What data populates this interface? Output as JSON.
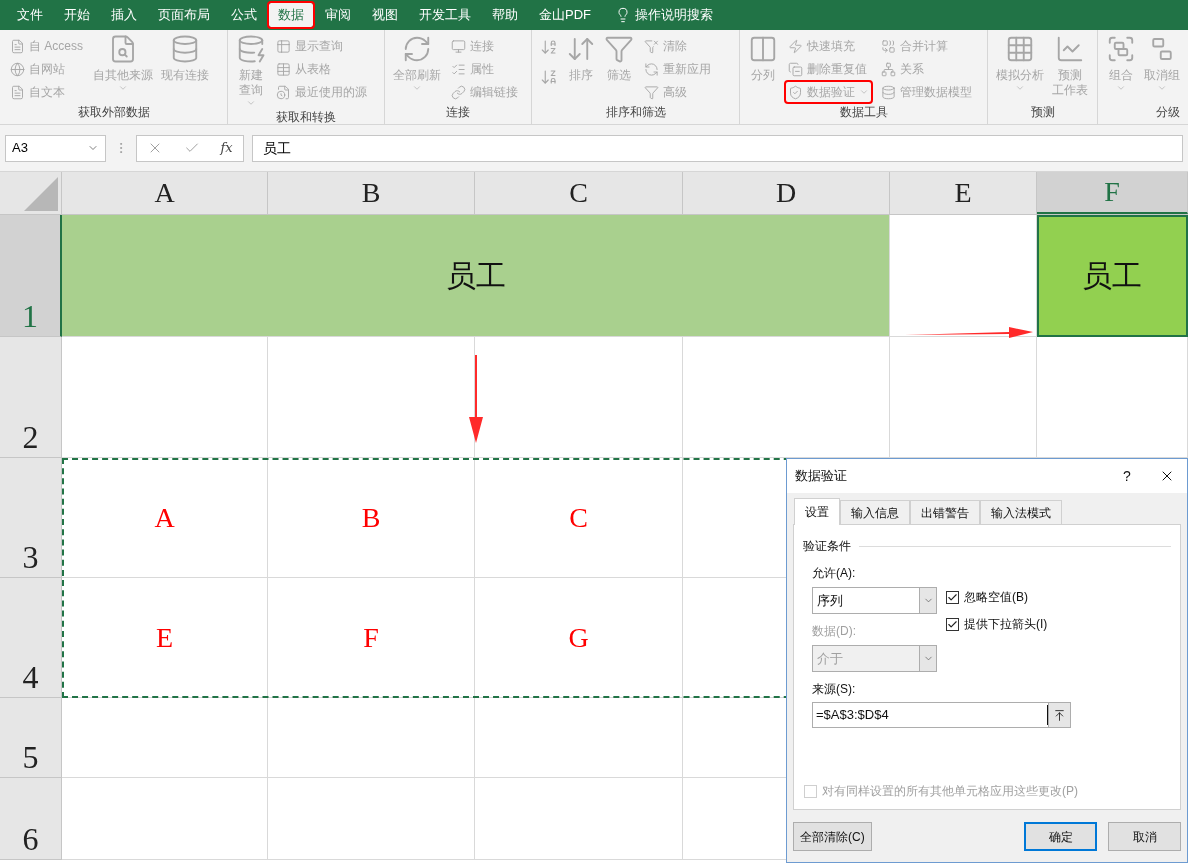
{
  "menu_tabs": [
    {
      "label": "文件",
      "selected": false,
      "highlighted": false
    },
    {
      "label": "开始",
      "selected": false,
      "highlighted": false
    },
    {
      "label": "插入",
      "selected": false,
      "highlighted": false
    },
    {
      "label": "页面布局",
      "selected": false,
      "highlighted": false
    },
    {
      "label": "公式",
      "selected": false,
      "highlighted": false
    },
    {
      "label": "数据",
      "selected": true,
      "highlighted": true
    },
    {
      "label": "审阅",
      "selected": false,
      "highlighted": false
    },
    {
      "label": "视图",
      "selected": false,
      "highlighted": false
    },
    {
      "label": "开发工具",
      "selected": false,
      "highlighted": false
    },
    {
      "label": "帮助",
      "selected": false,
      "highlighted": false
    },
    {
      "label": "金山PDF",
      "selected": false,
      "highlighted": false
    }
  ],
  "tell_me": {
    "placeholder": "操作说明搜索"
  },
  "ribbon": {
    "dimmed": true,
    "groups": [
      {
        "label": "获取外部数据",
        "items": [
          {
            "kind": "stack",
            "items": [
              {
                "label": "自 Access",
                "highlighted": false
              },
              {
                "label": "自网站",
                "highlighted": false
              },
              {
                "label": "自文本",
                "highlighted": false
              }
            ]
          },
          {
            "kind": "large",
            "label": "自其他来源",
            "caret": true
          },
          {
            "kind": "large",
            "label": "现有连接",
            "caret": false
          }
        ]
      },
      {
        "label": "获取和转换",
        "items": [
          {
            "kind": "large",
            "lines": [
              "新建",
              "查询"
            ],
            "caret": true
          },
          {
            "kind": "stack",
            "items": [
              {
                "label": "显示查询",
                "highlighted": false
              },
              {
                "label": "从表格",
                "highlighted": false
              },
              {
                "label": "最近使用的源",
                "highlighted": false
              }
            ]
          }
        ]
      },
      {
        "label": "连接",
        "items": [
          {
            "kind": "large",
            "label": "全部刷新",
            "caret": true
          },
          {
            "kind": "stack",
            "items": [
              {
                "label": "连接",
                "highlighted": false
              },
              {
                "label": "属性",
                "highlighted": false
              },
              {
                "label": "编辑链接",
                "highlighted": false
              }
            ]
          }
        ]
      },
      {
        "label": "排序和筛选",
        "items": [
          {
            "kind": "sort_icons"
          },
          {
            "kind": "large",
            "label": "排序",
            "caret": false
          },
          {
            "kind": "large",
            "label": "筛选",
            "caret": false
          },
          {
            "kind": "stack",
            "items": [
              {
                "label": "清除",
                "highlighted": false
              },
              {
                "label": "重新应用",
                "highlighted": false
              },
              {
                "label": "高级",
                "highlighted": false
              }
            ]
          }
        ]
      },
      {
        "label": "数据工具",
        "items": [
          {
            "kind": "large",
            "label": "分列",
            "caret": false
          },
          {
            "kind": "stack",
            "items": [
              {
                "label": "快速填充",
                "highlighted": false
              },
              {
                "label": "删除重复值",
                "highlighted": false
              },
              {
                "label": "数据验证",
                "highlighted": true
              }
            ]
          },
          {
            "kind": "stack",
            "items": [
              {
                "label": "合并计算",
                "highlighted": false
              },
              {
                "label": "关系",
                "highlighted": false
              },
              {
                "label": "管理数据模型",
                "highlighted": false
              }
            ]
          }
        ]
      },
      {
        "label": "预测",
        "items": [
          {
            "kind": "large",
            "label": "模拟分析",
            "caret": true
          },
          {
            "kind": "large",
            "lines": [
              "预测",
              "工作表"
            ],
            "caret": false
          }
        ]
      },
      {
        "label": "分级",
        "items": [
          {
            "kind": "large",
            "label": "组合",
            "caret": true
          },
          {
            "kind": "large",
            "label": "取消组",
            "caret": true
          }
        ]
      }
    ]
  },
  "formula_bar": {
    "name_box": "A3",
    "fx": "fx",
    "value": "员工"
  },
  "sheet": {
    "marquee": true,
    "columns": [
      {
        "label": "A",
        "selected": false
      },
      {
        "label": "B",
        "selected": false
      },
      {
        "label": "C",
        "selected": false
      },
      {
        "label": "D",
        "selected": false
      },
      {
        "label": "E",
        "selected": false
      },
      {
        "label": "F",
        "selected": true
      }
    ],
    "rows": [
      {
        "label": "1",
        "selected": true,
        "cells": [
          {
            "kind": "merged",
            "text": "员工",
            "color": "#a9d08e"
          },
          {
            "kind": "empty"
          },
          {
            "kind": "active",
            "text": "员工",
            "color": "#92d050"
          }
        ]
      },
      {
        "label": "2",
        "selected": false
      },
      {
        "label": "3",
        "selected": false,
        "cells": [
          {
            "kind": "text",
            "text": "A"
          },
          {
            "kind": "text",
            "text": "B"
          },
          {
            "kind": "text",
            "text": "C"
          },
          {
            "kind": "empty"
          },
          {
            "kind": "empty"
          },
          {
            "kind": "empty"
          }
        ]
      },
      {
        "label": "4",
        "selected": false,
        "cells": [
          {
            "kind": "text",
            "text": "E"
          },
          {
            "kind": "text",
            "text": "F"
          },
          {
            "kind": "text",
            "text": "G"
          },
          {
            "kind": "empty"
          },
          {
            "kind": "empty"
          },
          {
            "kind": "empty"
          }
        ]
      },
      {
        "label": "5",
        "selected": false
      },
      {
        "label": "6",
        "selected": false
      }
    ]
  },
  "dialog": {
    "title": "数据验证",
    "help": "?",
    "tabs": [
      {
        "label": "设置",
        "selected": true
      },
      {
        "label": "输入信息",
        "selected": false
      },
      {
        "label": "出错警告",
        "selected": false
      },
      {
        "label": "输入法模式",
        "selected": false
      }
    ],
    "section": "验证条件",
    "allow": {
      "label": "允许(A):",
      "value": "序列",
      "disabled": false
    },
    "data": {
      "label": "数据(D):",
      "value": "介于",
      "disabled": true
    },
    "checks": [
      {
        "label": "忽略空值(B)",
        "checked": true
      },
      {
        "label": "提供下拉箭头(I)",
        "checked": true
      }
    ],
    "source": {
      "label": "来源(S):",
      "value": "=$A$3:$D$4"
    },
    "apply_all": {
      "label": "对有同样设置的所有其他单元格应用这些更改(P)",
      "checked": false,
      "disabled": true
    },
    "buttons": [
      {
        "label": "全部清除(C)",
        "default": false
      },
      {
        "label": "确定",
        "default": true
      },
      {
        "label": "取消",
        "default": false
      }
    ]
  }
}
